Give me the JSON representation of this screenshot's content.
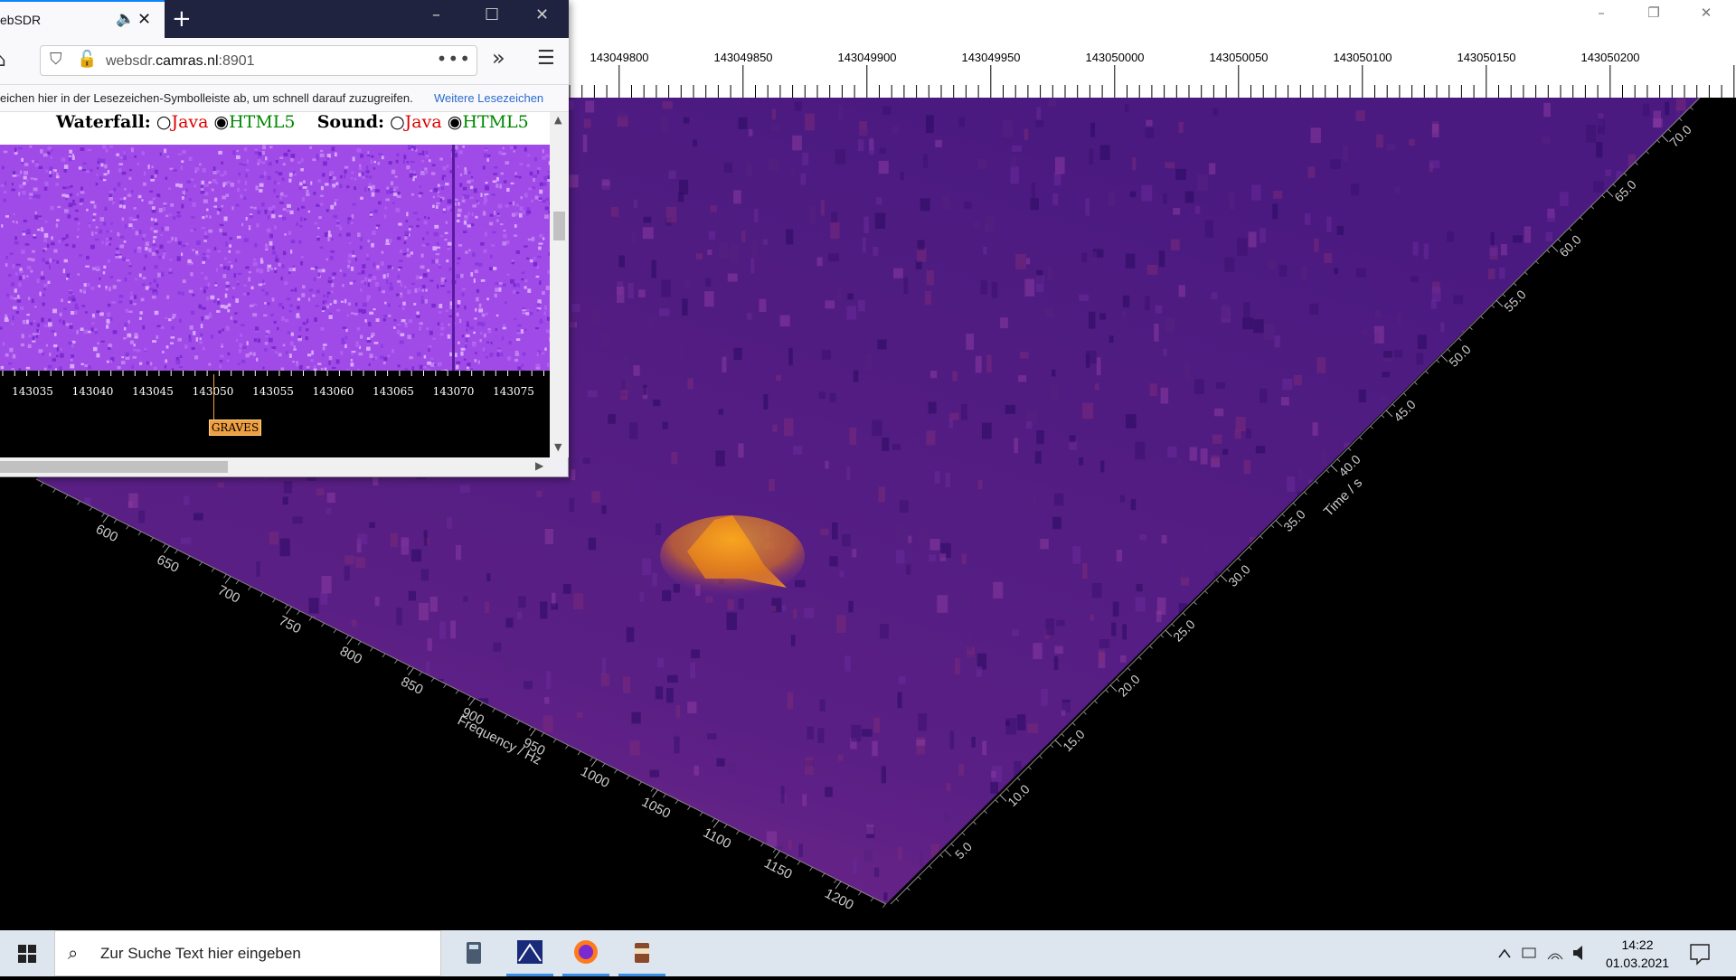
{
  "main_window": {
    "controls": {
      "minimize": "–",
      "restore": "❐",
      "close": "✕"
    }
  },
  "freq_ruler": {
    "labels": [
      "143049800",
      "143049850",
      "143049900",
      "143049950",
      "143050000",
      "143050050",
      "143050100",
      "143050150",
      "143050200"
    ]
  },
  "plot": {
    "frequency_ticks": [
      "600",
      "650",
      "700",
      "750",
      "800",
      "850",
      "900",
      "950",
      "1000",
      "1050",
      "1100",
      "1150",
      "1200"
    ],
    "frequency_axis_label": "Frequency / Hz",
    "time_ticks": [
      "5.0",
      "10.0",
      "15.0",
      "20.0",
      "25.0",
      "30.0",
      "35.0",
      "40.0",
      "45.0",
      "50.0",
      "55.0",
      "60.0",
      "65.0",
      "70.0"
    ],
    "time_axis_label": "Time / s",
    "colors": {
      "surface_base": "#3a1060",
      "surface_mid": "#6a2a9a",
      "peak": "#f5a020"
    }
  },
  "browser": {
    "tab_title": "ebSDR",
    "tab_icons": {
      "speaker": "speaker-icon",
      "close": "close-icon"
    },
    "new_tab": "+",
    "window_controls": {
      "minimize": "–",
      "maximize": "☐",
      "close": "✕"
    },
    "url_host_prefix": "websdr.",
    "url_host_main": "camras.nl",
    "url_port": ":8901",
    "url_menu": "•••",
    "overflow": "»",
    "menu": "☰",
    "bookmarks_hint": "eichen hier in der Lesezeichen-Symbolleiste ab, um schnell darauf zuzugreifen.",
    "bookmarks_more": "Weitere Lesezeichen",
    "page": {
      "waterfall_label": "Waterfall:",
      "sound_label": "Sound:",
      "java": "Java",
      "html5": "HTML5",
      "waterfall_selected": "HTML5",
      "sound_selected": "HTML5",
      "scale_labels": [
        "143035",
        "143040",
        "143045",
        "143050",
        "143055",
        "143060",
        "143065",
        "143070",
        "143075"
      ],
      "marker": "GRAVES",
      "waterfall_color": "#9b3fe6"
    }
  },
  "taskbar": {
    "search_placeholder": "Zur Suche Text hier eingeben",
    "apps": [
      "calculator-icon",
      "spectrum-lab-icon",
      "firefox-icon",
      "coffee-icon"
    ],
    "time": "14:22",
    "date": "01.03.2021"
  }
}
